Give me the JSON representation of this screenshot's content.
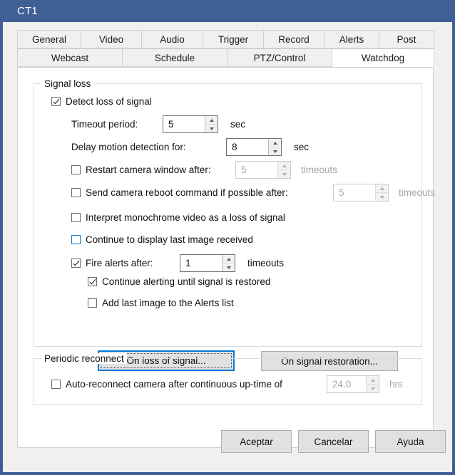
{
  "window": {
    "title": "CT1",
    "frame_color": "#3e6095"
  },
  "tabs": {
    "row1": [
      {
        "label": "General",
        "selected": false
      },
      {
        "label": "Video",
        "selected": false
      },
      {
        "label": "Audio",
        "selected": false
      },
      {
        "label": "Trigger",
        "selected": false
      },
      {
        "label": "Record",
        "selected": false
      },
      {
        "label": "Alerts",
        "selected": false
      },
      {
        "label": "Post",
        "selected": false
      }
    ],
    "row2": [
      {
        "label": "Webcast",
        "selected": false
      },
      {
        "label": "Schedule",
        "selected": false
      },
      {
        "label": "PTZ/Control",
        "selected": false
      },
      {
        "label": "Watchdog",
        "selected": true
      }
    ]
  },
  "signal_loss": {
    "group_label": "Signal loss",
    "detect": {
      "label": "Detect loss of signal",
      "checked": true
    },
    "timeout_period": {
      "label": "Timeout period:",
      "value": "5",
      "unit": "sec"
    },
    "delay_motion": {
      "label": "Delay motion detection for:",
      "value": "8",
      "unit": "sec"
    },
    "restart_window": {
      "label": "Restart camera window after:",
      "checked": false,
      "value": "5",
      "unit": "timeouts",
      "enabled": false
    },
    "reboot_command": {
      "label": "Send camera reboot command if possible after:",
      "checked": false,
      "value": "5",
      "unit": "timeouts",
      "enabled": false
    },
    "monochrome": {
      "label": "Interpret monochrome video as a loss of signal",
      "checked": false
    },
    "continue_display": {
      "label": "Continue to display last image received",
      "checked": false,
      "highlight": true
    },
    "fire_alerts": {
      "label": "Fire alerts after:",
      "checked": true,
      "value": "1",
      "unit": "timeouts"
    },
    "continue_alerting": {
      "label": "Continue alerting until signal is restored",
      "checked": true
    },
    "add_last_image": {
      "label": "Add last image to the Alerts list",
      "checked": false
    },
    "on_loss_button": "On loss of signal...",
    "on_restoration_button": "On signal restoration..."
  },
  "periodic_reconnect": {
    "group_label": "Periodic reconnect",
    "auto_reconnect": {
      "label": "Auto-reconnect camera after continuous up-time of",
      "checked": false,
      "value": "24.0",
      "unit": "hrs",
      "enabled": false
    }
  },
  "footer": {
    "accept": "Aceptar",
    "cancel": "Cancelar",
    "help": "Ayuda"
  }
}
